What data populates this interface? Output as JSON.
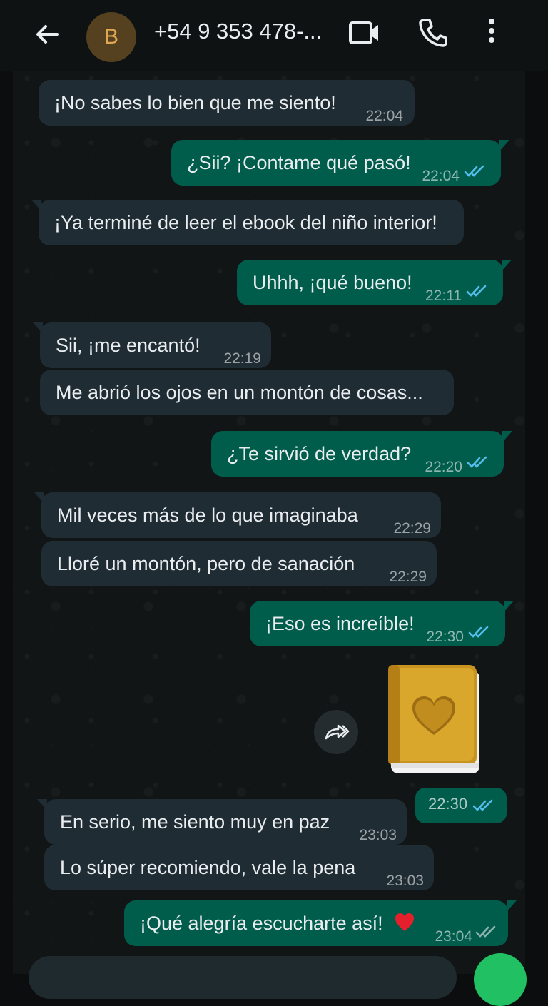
{
  "header": {
    "avatar_letter": "B",
    "contact_name": "+54 9 353 478-...",
    "back_icon": "arrow-left-icon",
    "video_icon": "video-camera-icon",
    "call_icon": "phone-icon",
    "menu_icon": "more-vertical-icon"
  },
  "colors": {
    "incoming_bubble": "#202c33",
    "outgoing_bubble": "#005c4b",
    "read_ticks": "#53bdeb",
    "avatar_bg": "#55401f",
    "avatar_letter": "#e0a651",
    "fab": "#21c063"
  },
  "messages": [
    {
      "dir": "in",
      "text": "¡No sabes lo bien que me siento!",
      "time": "22:04"
    },
    {
      "dir": "out",
      "text": "¿Sii? ¡Contame qué pasó!",
      "time": "22:04",
      "status": "read"
    },
    {
      "dir": "in",
      "text": "¡Ya terminé de leer el ebook del niño interior!",
      "time": ""
    },
    {
      "dir": "out",
      "text": "Uhhh, ¡qué bueno!",
      "time": "22:11",
      "status": "read"
    },
    {
      "dir": "in",
      "text": "Sii, ¡me encantó!",
      "time": "22:19"
    },
    {
      "dir": "in",
      "text": "Me abrió los ojos en un montón de cosas...",
      "time": ""
    },
    {
      "dir": "out",
      "text": "¿Te sirvió de verdad?",
      "time": "22:20",
      "status": "read"
    },
    {
      "dir": "in",
      "text": "Mil veces más de lo que imaginaba",
      "time": "22:29"
    },
    {
      "dir": "in",
      "text": "Lloré un montón, pero de sanación",
      "time": "22:29"
    },
    {
      "dir": "out",
      "text": "¡Eso es increíble!",
      "time": "22:30",
      "status": "read"
    },
    {
      "dir": "out",
      "type": "sticker",
      "sticker": "golden-book-heart-sticker",
      "time": "22:30",
      "status": "read"
    },
    {
      "dir": "in",
      "text": "En serio, me siento muy en paz",
      "time": "23:03"
    },
    {
      "dir": "in",
      "text": "Lo súper recomiendo, vale la pena",
      "time": "23:03"
    },
    {
      "dir": "out",
      "text": "¡Qué alegría escucharte así!",
      "emoji": "red-heart",
      "time": "23:04",
      "status": "delivered"
    }
  ]
}
